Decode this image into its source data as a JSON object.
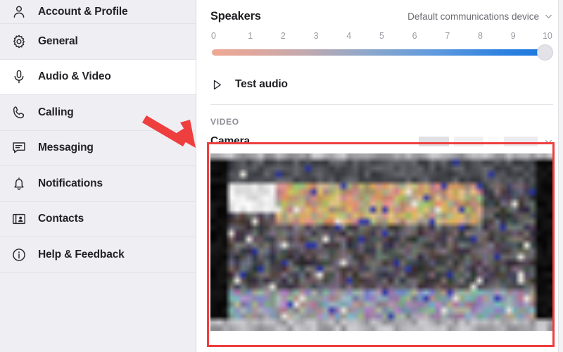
{
  "sidebar": {
    "items": [
      {
        "label": "Account & Profile",
        "icon": "person-icon",
        "selected": false
      },
      {
        "label": "General",
        "icon": "gear-icon",
        "selected": false
      },
      {
        "label": "Audio & Video",
        "icon": "microphone-icon",
        "selected": true
      },
      {
        "label": "Calling",
        "icon": "phone-icon",
        "selected": false
      },
      {
        "label": "Messaging",
        "icon": "chat-bubble-icon",
        "selected": false
      },
      {
        "label": "Notifications",
        "icon": "bell-icon",
        "selected": false
      },
      {
        "label": "Contacts",
        "icon": "contact-card-icon",
        "selected": false
      },
      {
        "label": "Help & Feedback",
        "icon": "info-circle-icon",
        "selected": false
      }
    ]
  },
  "main": {
    "speakers": {
      "title": "Speakers",
      "device": "Default communications device",
      "chevron_icon": "chevron-down-icon",
      "volume": {
        "ticks": [
          "0",
          "1",
          "2",
          "3",
          "4",
          "5",
          "6",
          "7",
          "8",
          "9",
          "10"
        ],
        "value": 10,
        "min": 0,
        "max": 10,
        "gradient_start": "#eda893",
        "gradient_end": "#1f78dd"
      }
    },
    "test_audio": {
      "label": "Test audio",
      "icon": "play-icon"
    },
    "video_section": {
      "label": "VIDEO",
      "camera": {
        "title": "Camera",
        "device": "",
        "device_redacted": true,
        "chevron_icon": "chevron-down-icon"
      }
    }
  },
  "annotations": {
    "highlight_color": "#ef3e3e",
    "arrow_icon": "arrow-pointing-down-right",
    "box_target": "Camera"
  }
}
